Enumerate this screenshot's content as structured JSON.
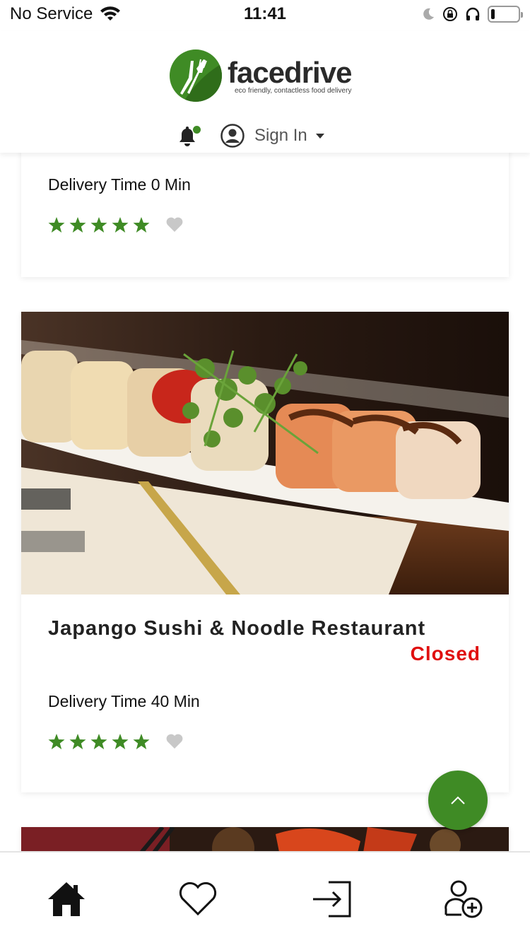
{
  "status_bar": {
    "carrier": "No Service",
    "time": "11:41",
    "battery_level": 0.15
  },
  "header": {
    "brand_name": "facedrive",
    "tagline": "eco friendly, contactless food delivery",
    "sign_in_label": "Sign In",
    "notification_dot": true
  },
  "colors": {
    "brand_green": "#3f8b25",
    "closed_red": "#e01010",
    "heart_gray": "#c8c8c8"
  },
  "restaurants": [
    {
      "delivery_time": "Delivery Time 0 Min",
      "rating": 5,
      "favorited": false
    },
    {
      "name": "Japango Sushi & Noodle Restaurant",
      "status": "Closed",
      "delivery_time": "Delivery Time 40 Min",
      "rating": 5,
      "favorited": false
    }
  ],
  "bottom_nav": {
    "items": [
      "home-icon",
      "heart-icon",
      "sign-in-icon",
      "add-user-icon"
    ]
  }
}
